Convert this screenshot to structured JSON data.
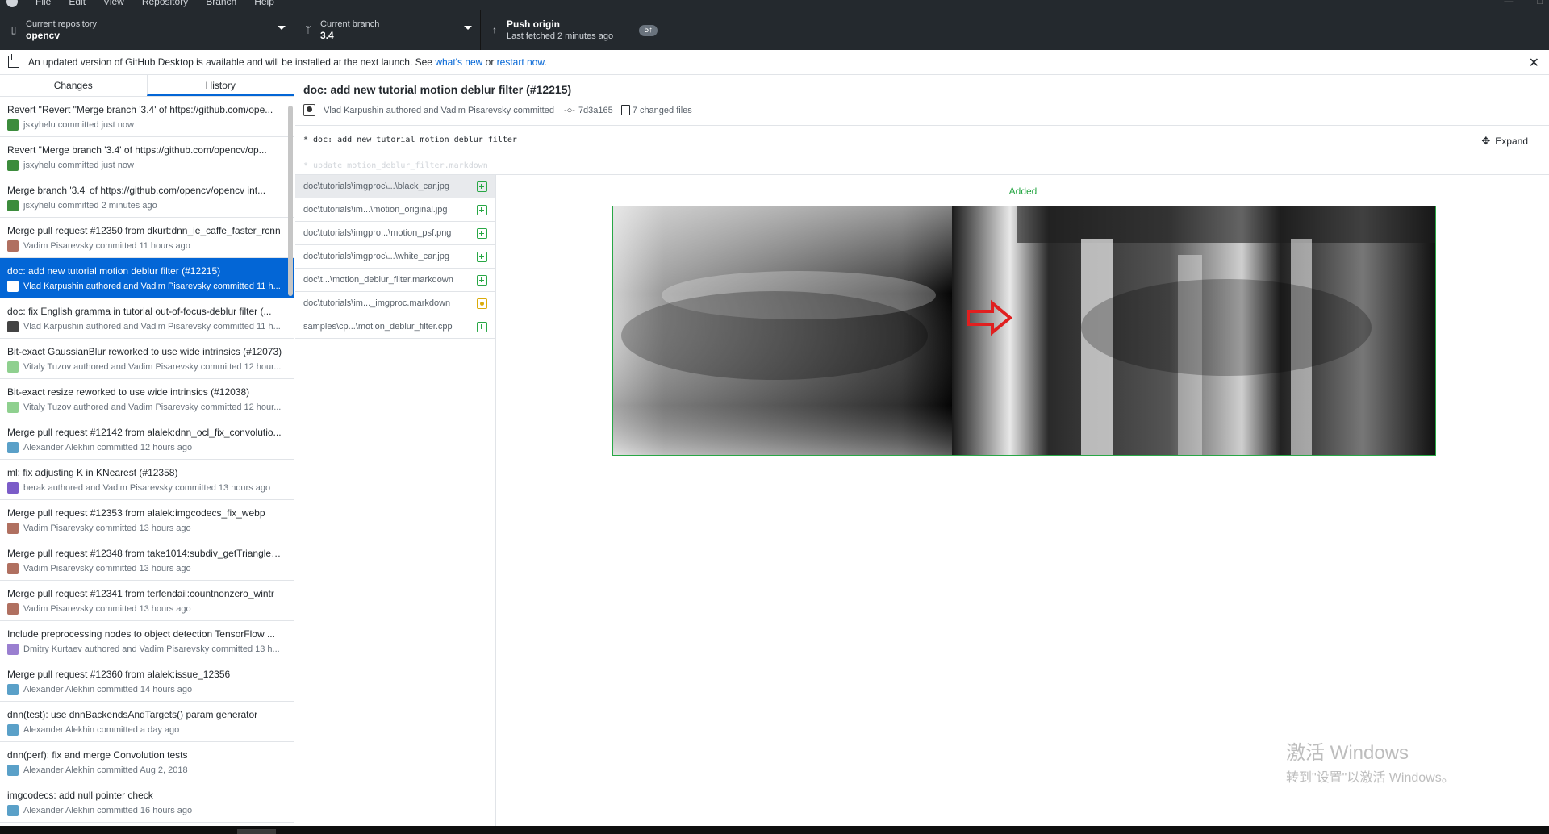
{
  "menubar": {
    "items": [
      "File",
      "Edit",
      "View",
      "Repository",
      "Branch",
      "Help"
    ]
  },
  "toolbar": {
    "repo_label": "Current repository",
    "repo_value": "opencv",
    "branch_label": "Current branch",
    "branch_value": "3.4",
    "push_title": "Push origin",
    "push_sub": "Last fetched 2 minutes ago",
    "push_badge": "5"
  },
  "banner": {
    "text_before": "An updated version of GitHub Desktop is available and will be installed at the next launch. See ",
    "link_whats_new": "what's new",
    "text_or": " or ",
    "link_restart": "restart now",
    "text_after": "."
  },
  "tabs": [
    "Changes",
    "History"
  ],
  "commits": [
    {
      "summary": "Revert \"Revert \"Merge branch '3.4' of https://github.com/ope...",
      "author": "jsxyhelu committed just now",
      "avatar_color": "#3c8c3c"
    },
    {
      "summary": "Revert \"Merge branch '3.4' of https://github.com/opencv/op...",
      "author": "jsxyhelu committed just now",
      "avatar_color": "#3c8c3c"
    },
    {
      "summary": "Merge branch '3.4' of https://github.com/opencv/opencv int...",
      "author": "jsxyhelu committed 2 minutes ago",
      "avatar_color": "#3c8c3c"
    },
    {
      "summary": "Merge pull request #12350 from dkurt:dnn_ie_caffe_faster_rcnn",
      "author": "Vadim Pisarevsky committed 11 hours ago",
      "avatar_color": "#b07060"
    },
    {
      "summary": "doc: add new tutorial motion deblur filter (#12215)",
      "author": "Vlad Karpushin authored and Vadim Pisarevsky committed 11 h...",
      "avatar_color": "#ffffff",
      "selected": true
    },
    {
      "summary": "doc: fix English gramma in tutorial out-of-focus-deblur filter (...",
      "author": "Vlad Karpushin authored and Vadim Pisarevsky committed 11 h...",
      "avatar_color": "#444444"
    },
    {
      "summary": "Bit-exact GaussianBlur reworked to use wide intrinsics (#12073)",
      "author": "Vitaly Tuzov authored and Vadim Pisarevsky committed 12 hour...",
      "avatar_color": "#8fd08f"
    },
    {
      "summary": "Bit-exact resize reworked to use wide intrinsics (#12038)",
      "author": "Vitaly Tuzov authored and Vadim Pisarevsky committed 12 hour...",
      "avatar_color": "#8fd08f"
    },
    {
      "summary": "Merge pull request #12142 from alalek:dnn_ocl_fix_convolutio...",
      "author": "Alexander Alekhin committed 12 hours ago",
      "avatar_color": "#5aa0c8"
    },
    {
      "summary": "ml: fix adjusting K in KNearest (#12358)",
      "author": "berak authored and Vadim Pisarevsky committed 13 hours ago",
      "avatar_color": "#7b5cc8"
    },
    {
      "summary": "Merge pull request #12353 from alalek:imgcodecs_fix_webp",
      "author": "Vadim Pisarevsky committed 13 hours ago",
      "avatar_color": "#b07060"
    },
    {
      "summary": "Merge pull request #12348 from take1014:subdiv_getTriangleL...",
      "author": "Vadim Pisarevsky committed 13 hours ago",
      "avatar_color": "#b07060"
    },
    {
      "summary": "Merge pull request #12341 from terfendail:countnonzero_wintr",
      "author": "Vadim Pisarevsky committed 13 hours ago",
      "avatar_color": "#b07060"
    },
    {
      "summary": "Include preprocessing nodes to object detection TensorFlow ...",
      "author": "Dmitry Kurtaev authored and Vadim Pisarevsky committed 13 h...",
      "avatar_color": "#9a7fd0"
    },
    {
      "summary": "Merge pull request #12360 from alalek:issue_12356",
      "author": "Alexander Alekhin committed 14 hours ago",
      "avatar_color": "#5aa0c8"
    },
    {
      "summary": "dnn(test): use dnnBackendsAndTargets() param generator",
      "author": "Alexander Alekhin committed a day ago",
      "avatar_color": "#5aa0c8"
    },
    {
      "summary": "dnn(perf): fix and merge Convolution tests",
      "author": "Alexander Alekhin committed Aug 2, 2018",
      "avatar_color": "#5aa0c8"
    },
    {
      "summary": "imgcodecs: add null pointer check",
      "author": "Alexander Alekhin committed 16 hours ago",
      "avatar_color": "#5aa0c8"
    }
  ],
  "commit_detail": {
    "title": "doc: add new tutorial motion deblur filter (#12215)",
    "authors": "Vlad Karpushin authored and Vadim Pisarevsky committed",
    "sha": "7d3a165",
    "changed_files": "7 changed files",
    "desc_line1": "* doc: add new tutorial motion deblur filter",
    "desc_line2": "* update motion_deblur_filter.markdown",
    "expand_label": "Expand"
  },
  "files": [
    {
      "path": "doc\\tutorials\\imgproc\\...\\black_car.jpg",
      "status": "added",
      "selected": true
    },
    {
      "path": "doc\\tutorials\\im...\\motion_original.jpg",
      "status": "added"
    },
    {
      "path": "doc\\tutorials\\imgpro...\\motion_psf.png",
      "status": "added"
    },
    {
      "path": "doc\\tutorials\\imgproc\\...\\white_car.jpg",
      "status": "added"
    },
    {
      "path": "doc\\t...\\motion_deblur_filter.markdown",
      "status": "added"
    },
    {
      "path": "doc\\tutorials\\im..._imgproc.markdown",
      "status": "modified"
    },
    {
      "path": "samples\\cp...\\motion_deblur_filter.cpp",
      "status": "added"
    }
  ],
  "diff": {
    "label": "Added"
  },
  "watermark": {
    "line1": "激活 Windows",
    "line2": "转到\"设置\"以激活 Windows。"
  },
  "colors": {
    "accent": "#0366d6",
    "toolbar": "#24292e",
    "added": "#28a745",
    "modified": "#dbab09"
  }
}
